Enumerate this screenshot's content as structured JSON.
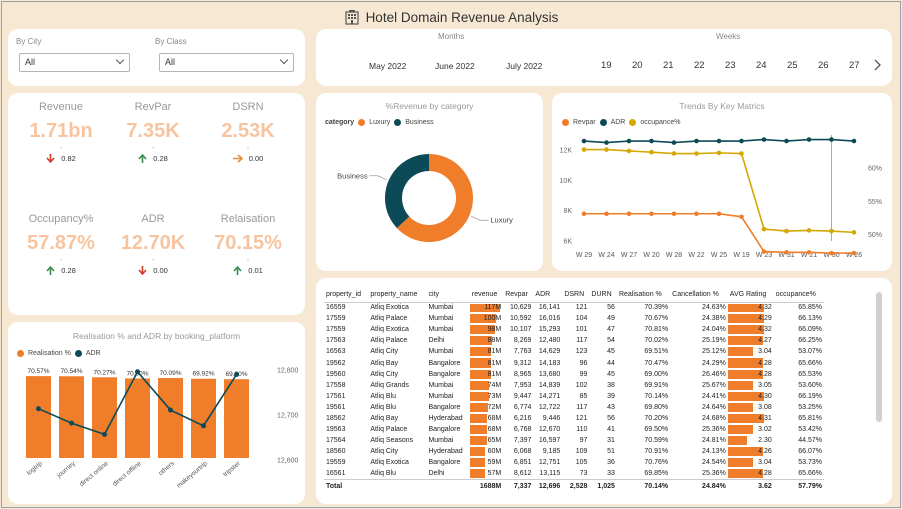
{
  "title": "Hotel Domain Revenue Analysis",
  "filters": {
    "city_label": "By City",
    "city_value": "All",
    "class_label": "By Class",
    "class_value": "All"
  },
  "months": {
    "label": "Months",
    "items": [
      "May 2022",
      "June 2022",
      "July 2022"
    ]
  },
  "weeks": {
    "label": "Weeks",
    "items": [
      "19",
      "20",
      "21",
      "22",
      "23",
      "24",
      "25",
      "26",
      "27"
    ]
  },
  "kpis": [
    {
      "label": "Revenue",
      "value": "1.71bn",
      "dot": "-",
      "delta": "0.82",
      "trend": "down"
    },
    {
      "label": "RevPar",
      "value": "7.35K",
      "dot": "-",
      "delta": "0.28",
      "trend": "up"
    },
    {
      "label": "DSRN",
      "value": "2.53K",
      "dot": "-",
      "delta": "0.00",
      "trend": "flat"
    },
    {
      "label": "Occupancy%",
      "value": "57.87%",
      "dot": "-",
      "delta": "0.28",
      "trend": "up"
    },
    {
      "label": "ADR",
      "value": "12.70K",
      "dot": "-",
      "delta": "0.00",
      "trend": "down"
    },
    {
      "label": "Relaisation",
      "value": "70.15%",
      "dot": "-",
      "delta": "0.01",
      "trend": "up"
    }
  ],
  "colors": {
    "orange": "#f07d2a",
    "teal": "#0d4a57",
    "gold": "#d4a800",
    "up": "#3c8c4f",
    "down": "#d33b2c",
    "flat": "#e0913a"
  },
  "chart_data": [
    {
      "type": "pie",
      "title": "%Revenue by category",
      "legend_title": "category",
      "categories": [
        "Luxury",
        "Business"
      ],
      "values": [
        63,
        37
      ],
      "colors": [
        "#f07d2a",
        "#0d4a57"
      ],
      "legend": "top-left"
    },
    {
      "type": "line",
      "title": "Trends By Key Matrics",
      "x": [
        "W 29",
        "W 24",
        "W 27",
        "W 20",
        "W 28",
        "W 22",
        "W 25",
        "W 19",
        "W 23",
        "W 31",
        "W 21",
        "W 30",
        "W 26"
      ],
      "series": [
        {
          "name": "Revpar",
          "axis": "left",
          "color": "#f07d2a",
          "values": [
            7800,
            7800,
            7800,
            7800,
            7800,
            7800,
            7800,
            7600,
            5300,
            5250,
            5250,
            5200,
            5200
          ]
        },
        {
          "name": "ADR",
          "axis": "left",
          "color": "#0d4a57",
          "values": [
            12600,
            12500,
            12600,
            12600,
            12500,
            12600,
            12600,
            12600,
            12700,
            12600,
            12700,
            12700,
            12600
          ]
        },
        {
          "name": "occupance%",
          "axis": "right",
          "color": "#d4a800",
          "values": [
            62.8,
            62.8,
            62.6,
            62.4,
            62.2,
            62.2,
            62.3,
            62.2,
            50.8,
            50.5,
            50.6,
            50.5,
            50.3
          ]
        }
      ],
      "y_ticks": [
        "12K",
        "10K",
        "8K",
        "6K"
      ],
      "y_left_range": [
        6000,
        13000
      ],
      "y2_ticks": [
        "60%",
        "55%",
        "50%"
      ],
      "y_right_range": [
        49,
        65
      ],
      "legend": "top-left"
    },
    {
      "type": "bar",
      "title": "Realisation % and ADR by booking_platform",
      "categories": [
        "logtrip",
        "journey",
        "direct online",
        "direct offline",
        "others",
        "makeyourtrip",
        "tripster"
      ],
      "series": [
        {
          "name": "Realisation %",
          "type": "bar",
          "color": "#f07d2a",
          "values": [
            70.57,
            70.54,
            70.27,
            70.0,
            70.09,
            69.92,
            69.8
          ],
          "labels": [
            "70.57%",
            "70.54%",
            "70.27%",
            "70.00%",
            "70.09%",
            "69.92%",
            "69.80%"
          ]
        },
        {
          "name": "ADR",
          "type": "line",
          "axis": "right",
          "color": "#0d4a57",
          "values": [
            12714,
            12682,
            12657,
            12796,
            12711,
            12676,
            12790
          ]
        }
      ],
      "y2_ticks": [
        "12,800",
        "12,700",
        "12,600"
      ],
      "y2_range": [
        12600,
        12800
      ],
      "legend": "top-left"
    }
  ],
  "table": {
    "columns": [
      "property_id",
      "property_name",
      "city",
      "revenue",
      "Revpar",
      "ADR",
      "DSRN",
      "DURN",
      "Realisation %",
      "Cancellation %",
      "AVG Rating",
      "occupance%"
    ],
    "rows": [
      [
        "16559",
        "Atliq Exotica",
        "Mumbai",
        "117M",
        "10,629",
        "16,141",
        "121",
        "56",
        "70.39%",
        "24.63%",
        "4.32",
        "65.85%"
      ],
      [
        "17559",
        "Atliq Palace",
        "Mumbai",
        "100M",
        "10,592",
        "16,016",
        "104",
        "49",
        "70.67%",
        "24.38%",
        "4.29",
        "66.13%"
      ],
      [
        "17559",
        "Atliq Exotica",
        "Mumbai",
        "98M",
        "10,107",
        "15,293",
        "101",
        "47",
        "70.81%",
        "24.04%",
        "4.32",
        "66.09%"
      ],
      [
        "17563",
        "Atliq Palace",
        "Delhi",
        "88M",
        "8,269",
        "12,480",
        "117",
        "54",
        "70.02%",
        "25.19%",
        "4.27",
        "66.25%"
      ],
      [
        "16563",
        "Atliq City",
        "Mumbai",
        "81M",
        "7,763",
        "14,629",
        "123",
        "45",
        "69.51%",
        "25.12%",
        "3.04",
        "53.07%"
      ],
      [
        "19562",
        "Atliq Bay",
        "Bangalore",
        "81M",
        "9,312",
        "14,183",
        "96",
        "44",
        "70.47%",
        "24.29%",
        "4.28",
        "65.66%"
      ],
      [
        "19560",
        "Atliq City",
        "Bangalore",
        "81M",
        "8,965",
        "13,680",
        "99",
        "45",
        "69.00%",
        "26.46%",
        "4.28",
        "65.53%"
      ],
      [
        "17558",
        "Atliq Grands",
        "Mumbai",
        "74M",
        "7,953",
        "14,839",
        "102",
        "38",
        "69.91%",
        "25.67%",
        "3.05",
        "53.60%"
      ],
      [
        "17561",
        "Atliq Blu",
        "Mumbai",
        "73M",
        "9,447",
        "14,271",
        "85",
        "39",
        "70.14%",
        "24.41%",
        "4.30",
        "66.19%"
      ],
      [
        "19561",
        "Atliq Blu",
        "Bangalore",
        "72M",
        "6,774",
        "12,722",
        "117",
        "43",
        "69.80%",
        "24.64%",
        "3.08",
        "53.25%"
      ],
      [
        "18562",
        "Atliq Bay",
        "Hyderabad",
        "68M",
        "6,216",
        "9,446",
        "121",
        "56",
        "70.20%",
        "24.68%",
        "4.31",
        "65.81%"
      ],
      [
        "19563",
        "Atliq Palace",
        "Bangalore",
        "68M",
        "6,768",
        "12,670",
        "110",
        "41",
        "69.50%",
        "25.36%",
        "3.02",
        "53.42%"
      ],
      [
        "17564",
        "Atliq Seasons",
        "Mumbai",
        "65M",
        "7,397",
        "16,597",
        "97",
        "31",
        "70.59%",
        "24.81%",
        "2.30",
        "44.57%"
      ],
      [
        "18560",
        "Atliq City",
        "Hyderabad",
        "60M",
        "6,068",
        "9,185",
        "109",
        "51",
        "70.91%",
        "24.13%",
        "4.26",
        "66.07%"
      ],
      [
        "19559",
        "Atliq Exotica",
        "Bangalore",
        "59M",
        "6,851",
        "12,751",
        "105",
        "36",
        "70.76%",
        "24.54%",
        "3.04",
        "53.73%"
      ],
      [
        "16561",
        "Atliq Blu",
        "Delhi",
        "57M",
        "8,612",
        "13,115",
        "73",
        "33",
        "69.85%",
        "25.36%",
        "4.28",
        "65.66%"
      ]
    ],
    "revenue_values": [
      117,
      100,
      98,
      88,
      81,
      81,
      81,
      74,
      73,
      72,
      68,
      68,
      65,
      60,
      59,
      57
    ],
    "rating_values": [
      4.32,
      4.29,
      4.32,
      4.27,
      3.04,
      4.28,
      4.28,
      3.05,
      4.3,
      3.08,
      4.31,
      3.02,
      2.3,
      4.26,
      3.04,
      4.28
    ],
    "total": [
      "Total",
      "",
      "",
      "1688M",
      "7,337",
      "12,696",
      "2,528",
      "1,025",
      "70.14%",
      "24.84%",
      "3.62",
      "57.79%"
    ]
  }
}
